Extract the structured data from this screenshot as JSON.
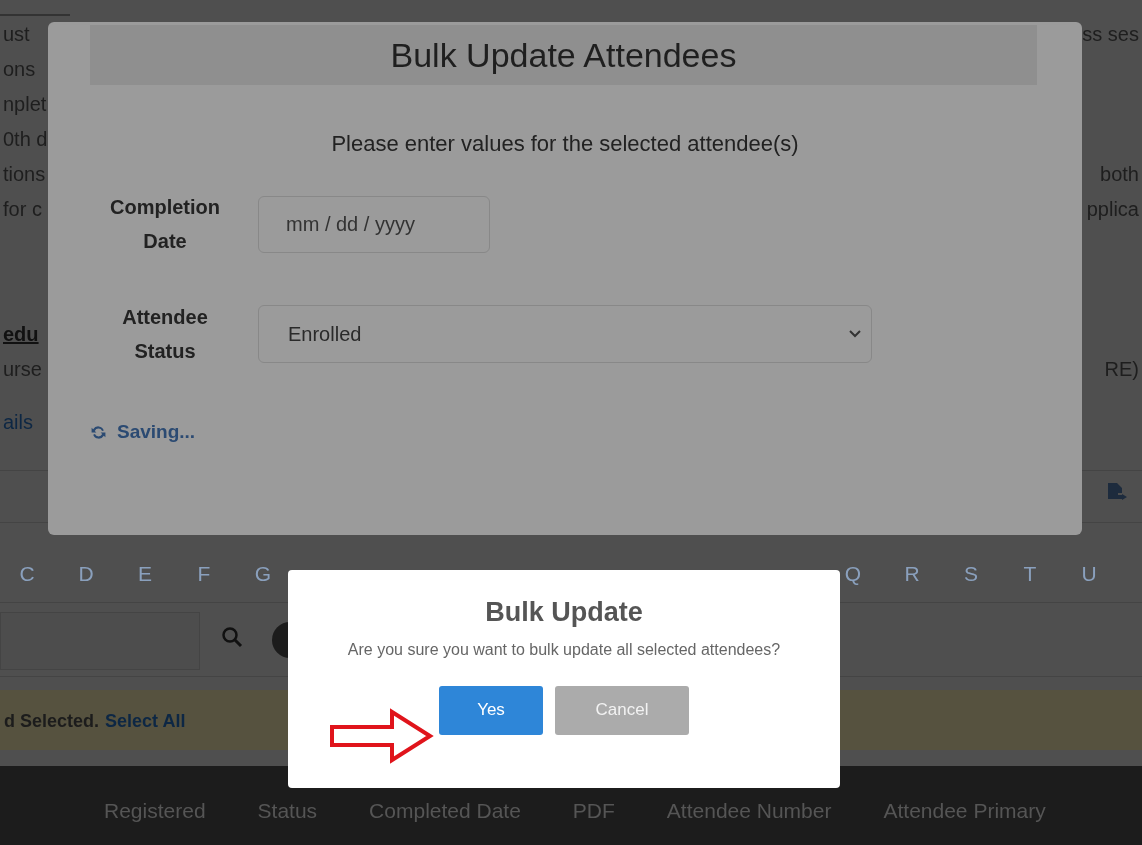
{
  "background_page": {
    "rows": [
      {
        "kind": "text",
        "left": "ust",
        "right": "ss ses"
      },
      {
        "kind": "text",
        "left": "ons"
      },
      {
        "kind": "text",
        "left": "nplet"
      },
      {
        "kind": "text",
        "left": "0th d"
      },
      {
        "kind": "text",
        "left": "tions",
        "right": "both"
      },
      {
        "kind": "text",
        "left": "for c",
        "right": "pplica"
      },
      {
        "kind": "heading",
        "left": "edu"
      },
      {
        "kind": "text",
        "left": "urse",
        "right": "RE)"
      },
      {
        "kind": "link",
        "left": "ails"
      }
    ],
    "letters_left": [
      "C",
      "D",
      "E",
      "F",
      "G"
    ],
    "letters_right": [
      "Q",
      "R",
      "S",
      "T",
      "U"
    ],
    "selection_bar": {
      "text": "d Selected.",
      "link": "Select All"
    },
    "table_columns": [
      "Registered",
      "Status",
      "Completed Date",
      "PDF",
      "Attendee Number",
      "Attendee Primary"
    ]
  },
  "edit_dialog": {
    "title": "Bulk Update Attendees",
    "instruction": "Please enter values for the selected attendee(s)",
    "fields": [
      {
        "kind": "date",
        "label": "Completion Date",
        "placeholder": "mm / dd / yyyy"
      },
      {
        "kind": "select",
        "label": "Attendee Status",
        "value": "Enrolled"
      }
    ],
    "status": "Saving..."
  },
  "confirm_dialog": {
    "title": "Bulk Update",
    "message": "Are you sure you want to bulk update all selected attendees?",
    "buttons": [
      {
        "label": "Yes",
        "kind": "primary"
      },
      {
        "label": "Cancel",
        "kind": "secondary"
      }
    ]
  }
}
